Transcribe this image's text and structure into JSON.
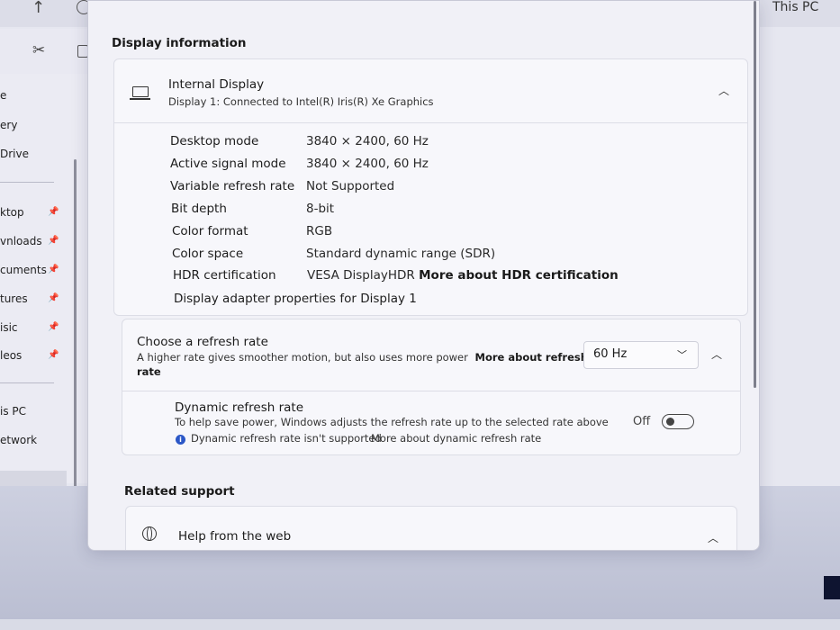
{
  "explorer": {
    "up_icon": "up-arrow-icon",
    "cut_icon": "scissors-icon",
    "this_pc_title": "This PC",
    "sidebar": [
      "e",
      "ery",
      "Drive",
      "ktop",
      "vnloads",
      "cuments",
      "tures",
      "isic",
      "leos",
      "is PC",
      "etwork"
    ]
  },
  "display_info": {
    "heading": "Display information",
    "monitor": {
      "icon": "laptop-icon",
      "title": "Internal Display",
      "subtitle": "Display 1: Connected to Intel(R) Iris(R) Xe Graphics"
    },
    "rows": [
      {
        "label": "Desktop mode",
        "value": "3840 × 2400, 60 Hz"
      },
      {
        "label": "Active signal mode",
        "value": "3840 × 2400, 60 Hz"
      },
      {
        "label": "Variable refresh rate",
        "value": "Not Supported"
      },
      {
        "label": "Bit depth",
        "value": "8-bit"
      },
      {
        "label": "Color format",
        "value": "RGB"
      },
      {
        "label": "Color space",
        "value": "Standard dynamic range (SDR)"
      }
    ],
    "hdr": {
      "label": "HDR certification",
      "value": "VESA DisplayHDR",
      "link": "More about HDR certification"
    },
    "adapter_link": "Display adapter properties for Display 1"
  },
  "refresh": {
    "title": "Choose a refresh rate",
    "description": "A higher rate gives smoother motion, but also uses more power",
    "link_line1": "More about refresh",
    "link_line2": "rate",
    "selected": "60 Hz"
  },
  "dynamic": {
    "title": "Dynamic refresh rate",
    "description": "To help save power, Windows adjusts the refresh rate up to the selected rate above",
    "notice": "Dynamic refresh rate isn't supported",
    "notice_link": "More about dynamic refresh rate",
    "toggle_label": "Off"
  },
  "related": {
    "heading": "Related support",
    "item": {
      "icon": "globe-icon",
      "label": "Help from the web"
    }
  },
  "colors": {
    "accent": "#2b57c7",
    "window_bg": "#f1f1f7",
    "card_bg": "#f7f7fb"
  }
}
